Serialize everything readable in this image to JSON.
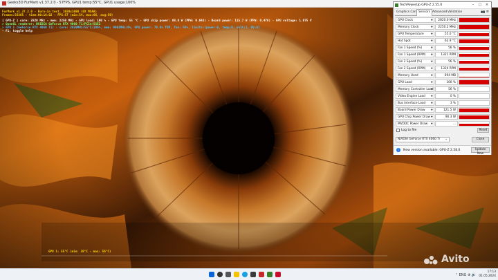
{
  "furmark": {
    "title": "Geeks3D FurMark v1.37.2.0 - 57FPS, GPU1 temp:55°C, GPU1 usage:100%",
    "overlay": [
      {
        "text": "FurMark v1.37.2.0 - Burn-in test, 1920x1080 (0X MSAA)",
        "color": "#ffd600"
      },
      {
        "text": "Frames:56365 - time:00:16:02 - FPS:57 (min:54, max:66, avg:59)",
        "color": "#ffd600"
      },
      {
        "text": "[ GPU-Z ] core: 2820 MHz - mem: 2250 MHz - GPU load: 100 % - GPU temp: 55 °C - GPU chip power: 88.8 W (PPW: 0.642) - Board power: 115.7 W (PPW: 0.478) - GPU voltage: 1.075 V",
        "color": "#ffffff"
      },
      {
        "text": "> OpenGL renderer: NVIDIA GeForce RTX 4060 Ti/PCIe/SSE2",
        "color": "#7cff7c"
      },
      {
        "text": "> GPU 1 (GeForce RTX 4060 Ti) - core: 2820MHz/55°C/100%, mem: 9001MHz/8%, GPU power: 76.8% TDP, fan: 56%, limits:[power:0, temp:0, volt:1, OV:0]",
        "color": "#4fc3ff"
      },
      {
        "text": "- F1: toggle help",
        "color": "#ffffff"
      }
    ],
    "graph_label": "GPU 1: 55°C (min: 38°C - max: 56°C)"
  },
  "gpuz": {
    "title": "TechPowerUp GPU-Z 2.55.0",
    "controls": [
      "–",
      "□",
      "×"
    ],
    "tabs": [
      {
        "label": "Graphics Card",
        "active": false
      },
      {
        "label": "Sensors",
        "active": true
      },
      {
        "label": "Advanced",
        "active": false
      },
      {
        "label": "Validation",
        "active": false
      }
    ],
    "tab_icons": "📷 ≡",
    "sensors": [
      {
        "label": "GPU Clock",
        "value": "2820.0 MHz",
        "level": 0.95
      },
      {
        "label": "Memory Clock",
        "value": "2250.2 MHz",
        "level": 0.95
      },
      {
        "label": "GPU Temperature",
        "value": "55.0 °C",
        "level": 0.75
      },
      {
        "label": "Hot Spot",
        "value": "62.9 °C",
        "level": 0.8
      },
      {
        "label": "Fan 1 Speed (%)",
        "value": "56 %",
        "level": 0.6
      },
      {
        "label": "Fan 1 Speed (RPM)",
        "value": "1321 RPM",
        "level": 0.6
      },
      {
        "label": "Fan 2 Speed (%)",
        "value": "56 %",
        "level": 0.6
      },
      {
        "label": "Fan 2 Speed (RPM)",
        "value": "1324 RPM",
        "level": 0.6
      },
      {
        "label": "Memory Used",
        "value": "694 MB",
        "level": 0.1
      },
      {
        "label": "GPU Load",
        "value": "100 %",
        "level": 1.0
      },
      {
        "label": "Memory Controller Load",
        "value": "56 %",
        "level": 0.0
      },
      {
        "label": "Video Engine Load",
        "value": "0 %",
        "level": 0.0
      },
      {
        "label": "Bus Interface Load",
        "value": "3 %",
        "level": 0.0
      },
      {
        "label": "Board Power Draw",
        "value": "121.5 W",
        "level": 0.85
      },
      {
        "label": "GPU Chip Power Draw",
        "value": "90.3 W",
        "level": 0.85
      },
      {
        "label": "MVDDC Power Draw",
        "value": "...",
        "level": 0.5
      }
    ],
    "log_to_file": "Log to file",
    "reset": "Reset",
    "gpu_name": "NVIDIA GeForce RTX 4060 Ti",
    "close": "Close",
    "update_msg": "New version available: GPU-Z 2.58.0",
    "update_btn": "Update Now"
  },
  "taskbar": {
    "time": "17:13",
    "date": "01.05.2024",
    "lang": "ENG",
    "tray_icons": "⌃ ENG ⊕ 🔊"
  },
  "watermark": "Avito"
}
